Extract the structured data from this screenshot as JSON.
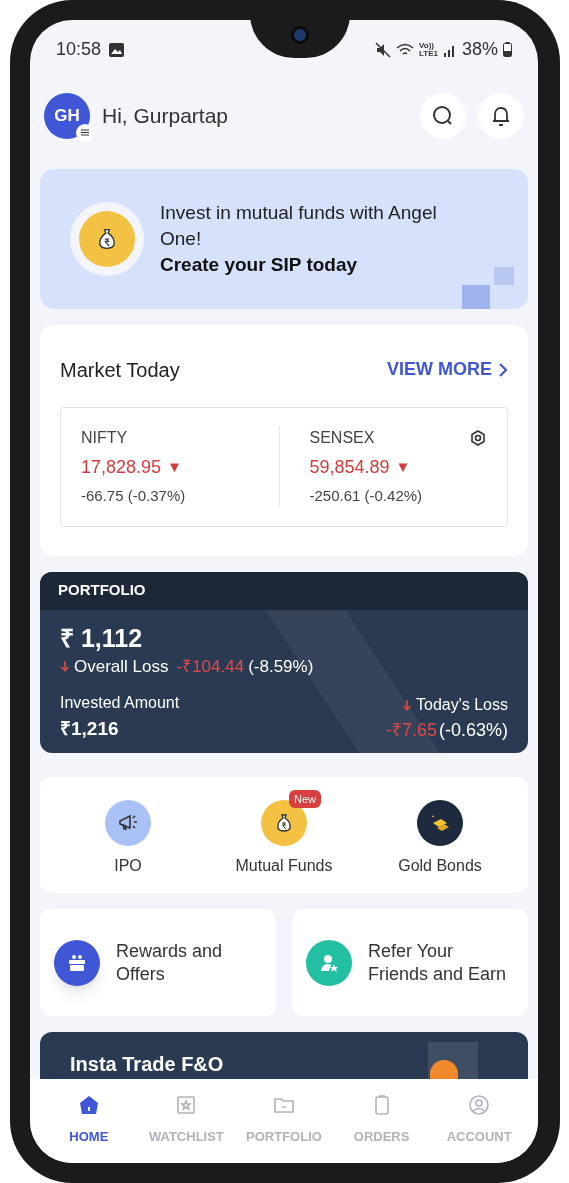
{
  "status_bar": {
    "time": "10:58",
    "network": "Vo))\nLTE1",
    "battery": "38%"
  },
  "header": {
    "avatar_initials": "GH",
    "greeting": "Hi, Gurpartap"
  },
  "promo": {
    "text": "Invest in mutual funds with Angel One!",
    "cta": "Create your SIP today"
  },
  "market": {
    "title": "Market Today",
    "link": "VIEW MORE",
    "indices": [
      {
        "name": "NIFTY",
        "value": "17,828.95",
        "marker": "▼",
        "change": "-66.75 (-0.37%)"
      },
      {
        "name": "SENSEX",
        "value": "59,854.89",
        "marker": "▼",
        "change": "-250.61 (-0.42%)"
      }
    ]
  },
  "portfolio": {
    "label": "PORTFOLIO",
    "value": "₹ 1,112",
    "overall_label": "Overall Loss",
    "overall_value": "-₹104.44",
    "overall_pct": "(-8.59%)",
    "invested_label": "Invested Amount",
    "invested_value": "₹1,216",
    "today_label": "Today's Loss",
    "today_value": "-₹7.65",
    "today_pct": "(-0.63%)"
  },
  "products": [
    {
      "kind": "ipo",
      "label": "IPO"
    },
    {
      "kind": "mutual_funds",
      "label": "Mutual Funds",
      "badge": "New"
    },
    {
      "kind": "gold",
      "label": "Gold Bonds"
    }
  ],
  "shortcuts": [
    {
      "kind": "rewards",
      "label": "Rewards and Offers"
    },
    {
      "kind": "refer",
      "label": "Refer Your Friends and Earn"
    }
  ],
  "banner": {
    "title": "Insta Trade F&O"
  },
  "nav": [
    {
      "kind": "home",
      "label": "HOME",
      "selected": true
    },
    {
      "kind": "watchlist",
      "label": "WATCHLIST",
      "selected": false
    },
    {
      "kind": "portfolio",
      "label": "PORTFOLIO",
      "selected": false
    },
    {
      "kind": "orders",
      "label": "ORDERS",
      "selected": false
    },
    {
      "kind": "account",
      "label": "ACCOUNT",
      "selected": false
    }
  ]
}
